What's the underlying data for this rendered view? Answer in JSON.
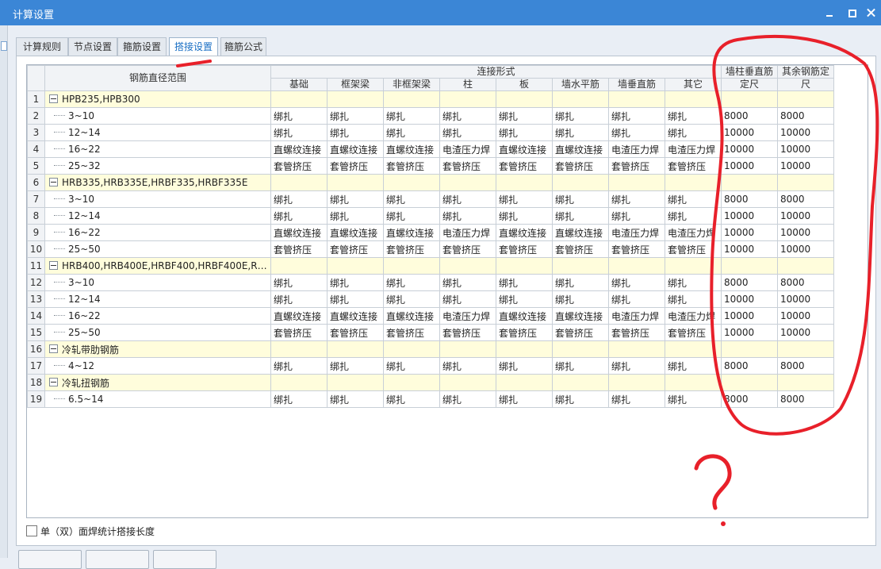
{
  "window": {
    "title": "计算设置"
  },
  "tabs": [
    {
      "label": "计算规则"
    },
    {
      "label": "节点设置"
    },
    {
      "label": "箍筋设置"
    },
    {
      "label": "搭接设置",
      "active": true
    },
    {
      "label": "箍筋公式"
    }
  ],
  "grid": {
    "header_range": "钢筋直径范围",
    "header_group": "连接形式",
    "connection_columns": [
      "基础",
      "框架梁",
      "非框架梁",
      "柱",
      "板",
      "墙水平筋",
      "墙垂直筋",
      "其它"
    ],
    "header_wall_line1": "墙柱垂直筋",
    "header_wall_line2": "定尺",
    "header_other_line1": "其余钢筋定",
    "header_other_line2": "尺",
    "rows": [
      {
        "num": "1",
        "group": true,
        "label": "HPB235,HPB300"
      },
      {
        "num": "2",
        "label": "3~10",
        "cells": [
          "绑扎",
          "绑扎",
          "绑扎",
          "绑扎",
          "绑扎",
          "绑扎",
          "绑扎",
          "绑扎",
          "8000",
          "8000"
        ]
      },
      {
        "num": "3",
        "label": "12~14",
        "cells": [
          "绑扎",
          "绑扎",
          "绑扎",
          "绑扎",
          "绑扎",
          "绑扎",
          "绑扎",
          "绑扎",
          "10000",
          "10000"
        ]
      },
      {
        "num": "4",
        "label": "16~22",
        "cells": [
          "直螺纹连接",
          "直螺纹连接",
          "直螺纹连接",
          "电渣压力焊",
          "直螺纹连接",
          "直螺纹连接",
          "电渣压力焊",
          "电渣压力焊",
          "10000",
          "10000"
        ]
      },
      {
        "num": "5",
        "label": "25~32",
        "cells": [
          "套管挤压",
          "套管挤压",
          "套管挤压",
          "套管挤压",
          "套管挤压",
          "套管挤压",
          "套管挤压",
          "套管挤压",
          "10000",
          "10000"
        ]
      },
      {
        "num": "6",
        "group": true,
        "label": "HRB335,HRB335E,HRBF335,HRBF335E"
      },
      {
        "num": "7",
        "label": "3~10",
        "cells": [
          "绑扎",
          "绑扎",
          "绑扎",
          "绑扎",
          "绑扎",
          "绑扎",
          "绑扎",
          "绑扎",
          "8000",
          "8000"
        ]
      },
      {
        "num": "8",
        "label": "12~14",
        "cells": [
          "绑扎",
          "绑扎",
          "绑扎",
          "绑扎",
          "绑扎",
          "绑扎",
          "绑扎",
          "绑扎",
          "10000",
          "10000"
        ]
      },
      {
        "num": "9",
        "label": "16~22",
        "cells": [
          "直螺纹连接",
          "直螺纹连接",
          "直螺纹连接",
          "电渣压力焊",
          "直螺纹连接",
          "直螺纹连接",
          "电渣压力焊",
          "电渣压力焊",
          "10000",
          "10000"
        ]
      },
      {
        "num": "10",
        "label": "25~50",
        "cells": [
          "套管挤压",
          "套管挤压",
          "套管挤压",
          "套管挤压",
          "套管挤压",
          "套管挤压",
          "套管挤压",
          "套管挤压",
          "10000",
          "10000"
        ]
      },
      {
        "num": "11",
        "group": true,
        "label": "HRB400,HRB400E,HRBF400,HRBF400E,RR..."
      },
      {
        "num": "12",
        "label": "3~10",
        "cells": [
          "绑扎",
          "绑扎",
          "绑扎",
          "绑扎",
          "绑扎",
          "绑扎",
          "绑扎",
          "绑扎",
          "8000",
          "8000"
        ]
      },
      {
        "num": "13",
        "label": "12~14",
        "cells": [
          "绑扎",
          "绑扎",
          "绑扎",
          "绑扎",
          "绑扎",
          "绑扎",
          "绑扎",
          "绑扎",
          "10000",
          "10000"
        ]
      },
      {
        "num": "14",
        "label": "16~22",
        "cells": [
          "直螺纹连接",
          "直螺纹连接",
          "直螺纹连接",
          "电渣压力焊",
          "直螺纹连接",
          "直螺纹连接",
          "电渣压力焊",
          "电渣压力焊",
          "10000",
          "10000"
        ]
      },
      {
        "num": "15",
        "label": "25~50",
        "cells": [
          "套管挤压",
          "套管挤压",
          "套管挤压",
          "套管挤压",
          "套管挤压",
          "套管挤压",
          "套管挤压",
          "套管挤压",
          "10000",
          "10000"
        ]
      },
      {
        "num": "16",
        "group": true,
        "label": "冷轧带肋钢筋"
      },
      {
        "num": "17",
        "label": "4~12",
        "cells": [
          "绑扎",
          "绑扎",
          "绑扎",
          "绑扎",
          "绑扎",
          "绑扎",
          "绑扎",
          "绑扎",
          "8000",
          "8000"
        ]
      },
      {
        "num": "18",
        "group": true,
        "label": "冷轧扭钢筋"
      },
      {
        "num": "19",
        "label": "6.5~14",
        "cells": [
          "绑扎",
          "绑扎",
          "绑扎",
          "绑扎",
          "绑扎",
          "绑扎",
          "绑扎",
          "绑扎",
          "8000",
          "8000"
        ]
      }
    ]
  },
  "options": {
    "weld_checkbox_label": "单（双）面焊统计搭接长度",
    "weld_checked": false
  },
  "annotations": {
    "question_mark": "?"
  },
  "colors": {
    "titlebar": "#3b86d6",
    "group_row": "#fffddc",
    "annotation": "#e8202a",
    "active_tab_text": "#1a6fc4"
  }
}
